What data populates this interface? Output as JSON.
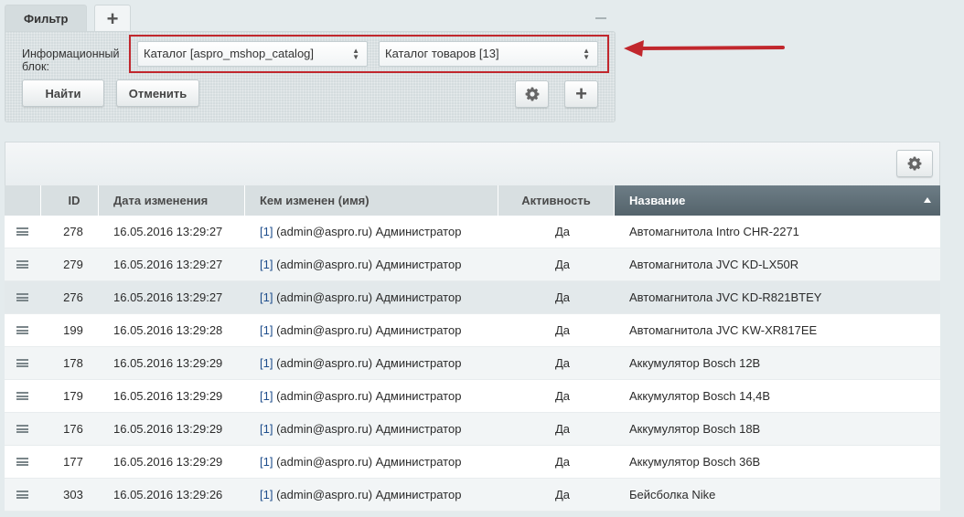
{
  "filter": {
    "tab_label": "Фильтр",
    "add_tab_symbol": "+",
    "iblock_label": "Информационный блок:",
    "select_type": "Каталог [aspro_mshop_catalog]",
    "select_iblock": "Каталог товаров [13]",
    "find_label": "Найти",
    "cancel_label": "Отменить",
    "add_symbol": "+"
  },
  "grid": {
    "columns": [
      {
        "label": "ID"
      },
      {
        "label": "Дата изменения"
      },
      {
        "label": "Кем изменен (имя)"
      },
      {
        "label": "Активность"
      },
      {
        "label": "Название",
        "sorted": "asc"
      }
    ],
    "rows": [
      {
        "id": "278",
        "date": "16.05.2016 13:29:27",
        "by_id": "[1]",
        "by_rest": "(admin@aspro.ru) Администратор",
        "active": "Да",
        "name": "Автомагнитола Intro CHR-2271"
      },
      {
        "id": "279",
        "date": "16.05.2016 13:29:27",
        "by_id": "[1]",
        "by_rest": "(admin@aspro.ru) Администратор",
        "active": "Да",
        "name": "Автомагнитола JVC KD-LX50R"
      },
      {
        "id": "276",
        "date": "16.05.2016 13:29:27",
        "by_id": "[1]",
        "by_rest": "(admin@aspro.ru) Администратор",
        "active": "Да",
        "name": "Автомагнитола JVC KD-R821BTEY"
      },
      {
        "id": "199",
        "date": "16.05.2016 13:29:28",
        "by_id": "[1]",
        "by_rest": "(admin@aspro.ru) Администратор",
        "active": "Да",
        "name": "Автомагнитола JVC KW-XR817EE"
      },
      {
        "id": "178",
        "date": "16.05.2016 13:29:29",
        "by_id": "[1]",
        "by_rest": "(admin@aspro.ru) Администратор",
        "active": "Да",
        "name": "Аккумулятор Bosch 12В"
      },
      {
        "id": "179",
        "date": "16.05.2016 13:29:29",
        "by_id": "[1]",
        "by_rest": "(admin@aspro.ru) Администратор",
        "active": "Да",
        "name": "Аккумулятор Bosch 14,4В"
      },
      {
        "id": "176",
        "date": "16.05.2016 13:29:29",
        "by_id": "[1]",
        "by_rest": "(admin@aspro.ru) Администратор",
        "active": "Да",
        "name": "Аккумулятор Bosch 18В"
      },
      {
        "id": "177",
        "date": "16.05.2016 13:29:29",
        "by_id": "[1]",
        "by_rest": "(admin@aspro.ru) Администратор",
        "active": "Да",
        "name": "Аккумулятор Bosch 36В"
      },
      {
        "id": "303",
        "date": "16.05.2016 13:29:26",
        "by_id": "[1]",
        "by_rest": "(admin@aspro.ru) Администратор",
        "active": "Да",
        "name": "Бейсболка Nike"
      }
    ]
  },
  "colors": {
    "annotation": "#c1272d",
    "active_header": "#5e6e77",
    "link": "#1f4e8c"
  }
}
